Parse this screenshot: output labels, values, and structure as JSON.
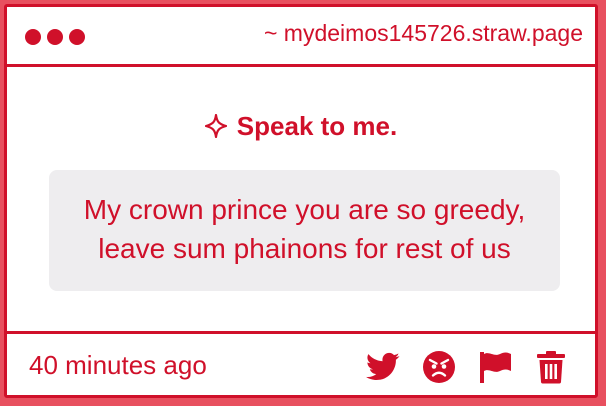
{
  "window": {
    "url": "~ mydeimos145726.straw.page"
  },
  "prompt": {
    "heading": "Speak to me."
  },
  "message": {
    "text": "My crown prince you are so greedy, leave sum phainons for rest of us"
  },
  "footer": {
    "timestamp": "40 minutes ago",
    "actions": [
      "twitter-icon",
      "angry-face-icon",
      "flag-icon",
      "trash-icon"
    ]
  },
  "colors": {
    "accent": "#d0102a",
    "page_background": "#e8505f",
    "message_background": "#eeedef"
  }
}
